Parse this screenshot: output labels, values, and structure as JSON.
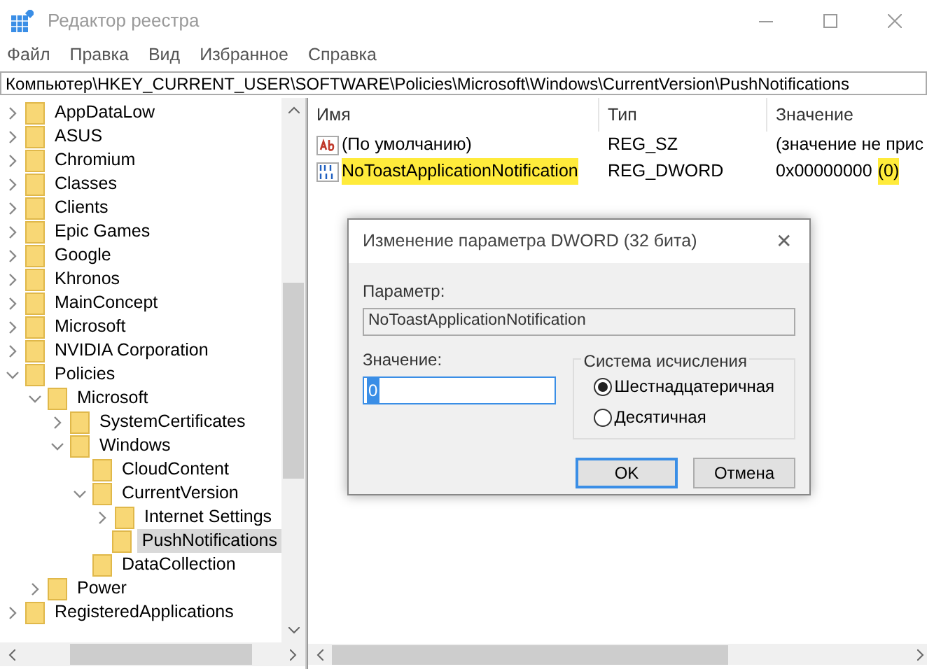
{
  "window": {
    "title": "Редактор реестра"
  },
  "menu": [
    "Файл",
    "Правка",
    "Вид",
    "Избранное",
    "Справка"
  ],
  "address": "Компьютер\\HKEY_CURRENT_USER\\SOFTWARE\\Policies\\Microsoft\\Windows\\CurrentVersion\\PushNotifications",
  "tree": [
    {
      "label": "AppDataLow",
      "expanded": false,
      "selected": false
    },
    {
      "label": "ASUS",
      "expanded": false,
      "selected": false
    },
    {
      "label": "Chromium",
      "expanded": false,
      "selected": false
    },
    {
      "label": "Classes",
      "expanded": false,
      "selected": false
    },
    {
      "label": "Clients",
      "expanded": false,
      "selected": false
    },
    {
      "label": "Epic Games",
      "expanded": false,
      "selected": false
    },
    {
      "label": "Google",
      "expanded": false,
      "selected": false
    },
    {
      "label": "Khronos",
      "expanded": false,
      "selected": false
    },
    {
      "label": "MainConcept",
      "expanded": false,
      "selected": false
    },
    {
      "label": "Microsoft",
      "expanded": false,
      "selected": false
    },
    {
      "label": "NVIDIA Corporation",
      "expanded": false,
      "selected": false
    },
    {
      "label": "Policies",
      "expanded": true,
      "selected": false,
      "children": [
        {
          "label": "Microsoft",
          "expanded": true,
          "selected": false,
          "children": [
            {
              "label": "SystemCertificates",
              "expanded": false,
              "selected": false
            },
            {
              "label": "Windows",
              "expanded": true,
              "selected": false,
              "children": [
                {
                  "label": "CloudContent",
                  "selected": false
                },
                {
                  "label": "CurrentVersion",
                  "expanded": true,
                  "selected": false,
                  "children": [
                    {
                      "label": "Internet Settings",
                      "expanded": false,
                      "selected": false
                    },
                    {
                      "label": "PushNotifications",
                      "selected": true
                    }
                  ]
                },
                {
                  "label": "DataCollection",
                  "selected": false
                }
              ]
            }
          ]
        },
        {
          "label": "Power",
          "expanded": false,
          "selected": false
        }
      ]
    },
    {
      "label": "RegisteredApplications",
      "expanded": false,
      "selected": false
    }
  ],
  "table": {
    "columns": [
      "Имя",
      "Тип",
      "Значение"
    ],
    "rows": [
      {
        "kind": "string",
        "name": "(По умолчанию)",
        "name_highlighted": false,
        "type": "REG_SZ",
        "value": [
          {
            "text": "(значение не прис",
            "highlighted": false
          }
        ]
      },
      {
        "kind": "binary",
        "name": "NoToastApplicationNotification",
        "name_highlighted": true,
        "type": "REG_DWORD",
        "value": [
          {
            "text": "0x00000000",
            "highlighted": false
          },
          {
            "text": "(0)",
            "highlighted": true
          }
        ]
      }
    ]
  },
  "dialog": {
    "title": "Изменение параметра DWORD (32 бита)",
    "close": "✕",
    "param_label": "Параметр:",
    "param_value": "NoToastApplicationNotification",
    "value_label": "Значение:",
    "value": "0",
    "base_group": "Система исчисления",
    "bases": [
      {
        "label": "Шестнадцатеричная",
        "selected": true
      },
      {
        "label": "Десятичная",
        "selected": false
      }
    ],
    "buttons": [
      "OK",
      "Отмена"
    ]
  }
}
